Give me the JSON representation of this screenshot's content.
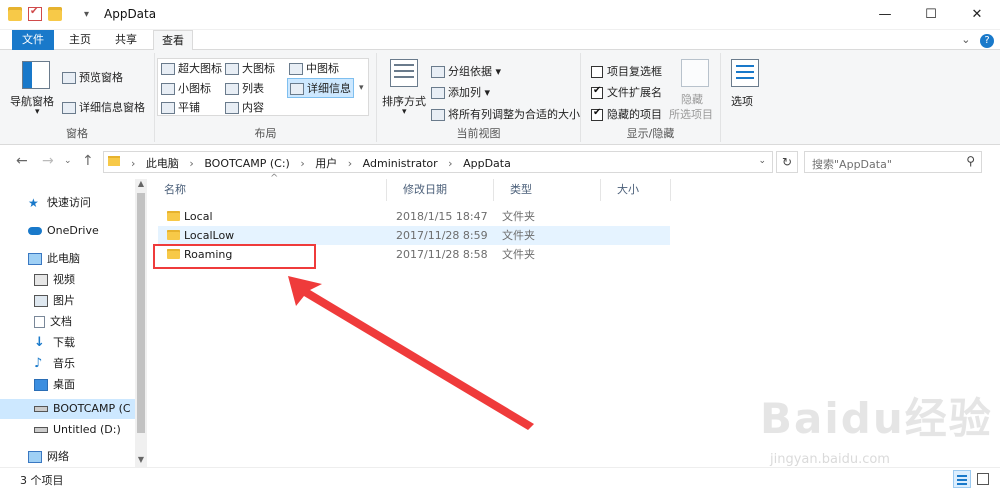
{
  "window": {
    "title": "AppData",
    "minimize_glyph": "—",
    "maximize_glyph": "☐",
    "close_glyph": "✕"
  },
  "tabs": {
    "file": "文件",
    "home": "主页",
    "share": "共享",
    "view": "查看",
    "expand_glyph": "⌄"
  },
  "ribbon": {
    "panes": {
      "label": "窗格",
      "nav_pane": "导航窗格",
      "preview_pane": "预览窗格",
      "details_pane": "详细信息窗格"
    },
    "layout": {
      "label": "布局",
      "extra_large": "超大图标",
      "large": "大图标",
      "medium": "中图标",
      "small": "小图标",
      "list": "列表",
      "details": "详细信息",
      "tiles": "平铺",
      "content": "内容"
    },
    "current_view": {
      "label": "当前视图",
      "sort_by": "排序方式",
      "group_by": "分组依据",
      "add_columns": "添加列",
      "size_all_columns": "将所有列调整为合适的大小"
    },
    "show_hide": {
      "label": "显示/隐藏",
      "item_checkboxes": "项目复选框",
      "item_checkboxes_checked": false,
      "file_extensions": "文件扩展名",
      "file_extensions_checked": true,
      "hidden_items": "隐藏的项目",
      "hidden_items_checked": true,
      "hide_selected_line1": "隐藏",
      "hide_selected_line2": "所选项目"
    },
    "options": "选项"
  },
  "address": {
    "crumbs": [
      "此电脑",
      "BOOTCAMP (C:)",
      "用户",
      "Administrator",
      "AppData"
    ],
    "search_placeholder": "搜索\"AppData\""
  },
  "nav": {
    "items": [
      {
        "label": "快速访问",
        "icon": "star-icon"
      },
      {
        "label": "OneDrive",
        "icon": "cloud-icon"
      },
      {
        "label": "此电脑",
        "icon": "computer-icon"
      },
      {
        "label": "视频",
        "icon": "video-icon"
      },
      {
        "label": "图片",
        "icon": "pictures-icon"
      },
      {
        "label": "文档",
        "icon": "documents-icon"
      },
      {
        "label": "下载",
        "icon": "download-icon"
      },
      {
        "label": "音乐",
        "icon": "music-icon"
      },
      {
        "label": "桌面",
        "icon": "desktop-icon"
      },
      {
        "label": "BOOTCAMP (C",
        "icon": "drive-icon"
      },
      {
        "label": "Untitled (D:)",
        "icon": "drive-icon"
      },
      {
        "label": "网络",
        "icon": "network-icon"
      }
    ]
  },
  "columns": {
    "name": "名称",
    "date": "修改日期",
    "type": "类型",
    "size": "大小"
  },
  "files": [
    {
      "name": "Local",
      "date": "2018/1/15 18:47",
      "type": "文件夹"
    },
    {
      "name": "LocalLow",
      "date": "2017/11/28 8:59",
      "type": "文件夹"
    },
    {
      "name": "Roaming",
      "date": "2017/11/28 8:58",
      "type": "文件夹"
    }
  ],
  "status": {
    "item_count": "3 个项目"
  },
  "watermark": {
    "brand": "Baidu经验",
    "url": "jingyan.baidu.com"
  },
  "colors": {
    "accent": "#1979ca",
    "annotation": "#ef3b3b",
    "selection": "#cde8ff",
    "hover": "#e5f3ff"
  }
}
